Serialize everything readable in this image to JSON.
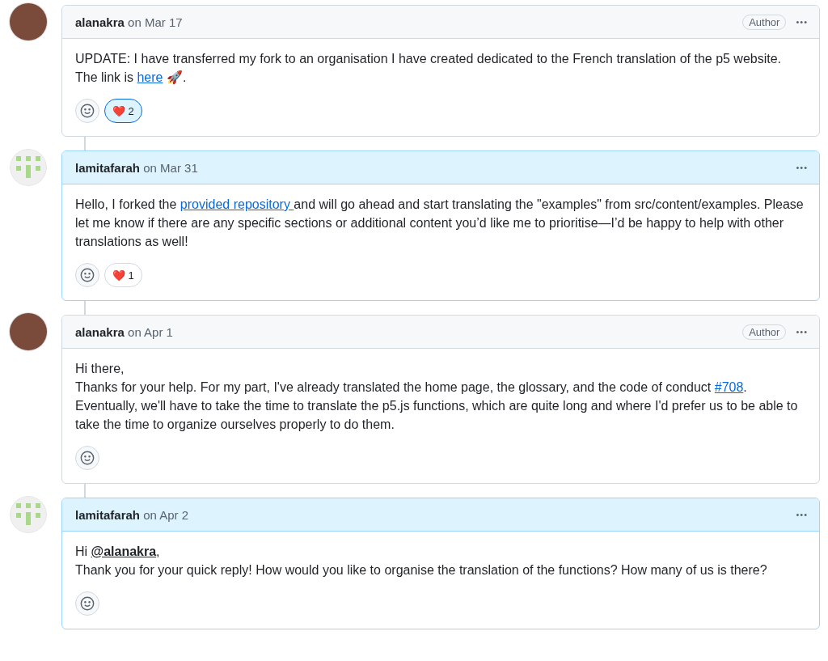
{
  "comments": [
    {
      "author": "alanakra",
      "date": "on Mar 17",
      "avatar": {
        "kind": "photo"
      },
      "highlighted": false,
      "badge": "Author",
      "more": "•••",
      "paragraphs": [
        [
          {
            "text": "UPDATE: I have transferred my fork to an organisation I have created dedicated to the French translation of the p5 website. The link is "
          },
          {
            "link": "here"
          },
          {
            "text": " 🚀."
          }
        ]
      ],
      "reactions": [
        {
          "emoji": "❤️",
          "count": "2",
          "selected": true
        }
      ]
    },
    {
      "author": "lamitafarah",
      "date": "on Mar 31",
      "avatar": {
        "kind": "identicon"
      },
      "highlighted": true,
      "more": "•••",
      "paragraphs": [
        [
          {
            "text": "Hello, I forked the "
          },
          {
            "link": "provided repository "
          },
          {
            "text": "and will go ahead and start translating the \"examples\" from src/content/examples. Please let me know if there are any specific sections or additional content you’d like me to prioritise—I’d be happy to help with other translations as well!"
          }
        ]
      ],
      "reactions": [
        {
          "emoji": "❤️",
          "count": "1",
          "selected": false
        }
      ]
    },
    {
      "author": "alanakra",
      "date": "on Apr 1",
      "avatar": {
        "kind": "photo"
      },
      "highlighted": false,
      "badge": "Author",
      "more": "•••",
      "paragraphs": [
        [
          {
            "text": "Hi there,"
          }
        ],
        [
          {
            "text": "Thanks for your help. For my part, I've already translated the home page, the glossary, and the code of conduct "
          },
          {
            "link": "#708"
          },
          {
            "text": ". Eventually, we'll have to take the time to translate the p5.js functions, which are quite long and where I'd prefer us to be able to take the time to organize ourselves properly to do them."
          }
        ]
      ]
    },
    {
      "author": "lamitafarah",
      "date": "on Apr 2",
      "avatar": {
        "kind": "identicon"
      },
      "highlighted": true,
      "more": "•••",
      "paragraphs": [
        [
          {
            "text": "Hi "
          },
          {
            "mention": "@alanakra"
          },
          {
            "text": ","
          }
        ],
        [
          {
            "text": "Thank you for your quick reply! How would you like to organise the translation of the functions? How many of us is there?"
          }
        ]
      ]
    }
  ]
}
